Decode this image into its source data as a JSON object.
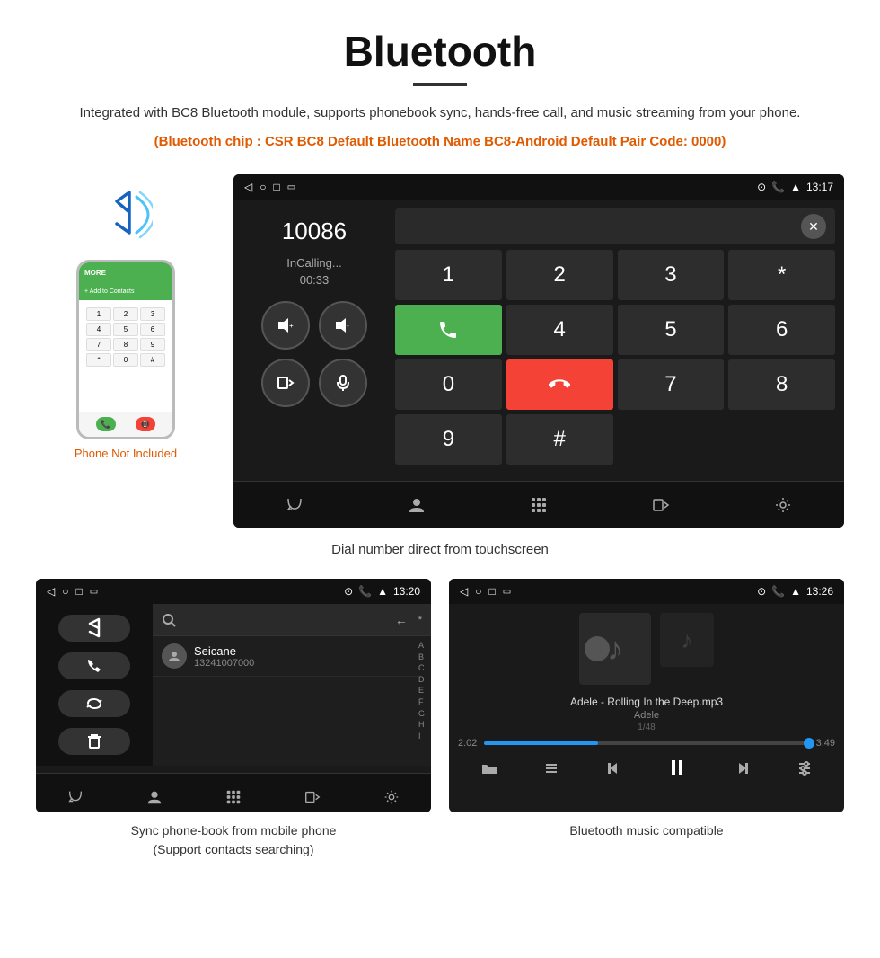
{
  "header": {
    "title": "Bluetooth",
    "description": "Integrated with BC8 Bluetooth module, supports phonebook sync, hands-free call, and music streaming from your phone.",
    "specs": "(Bluetooth chip : CSR BC8    Default Bluetooth Name BC8-Android    Default Pair Code: 0000)"
  },
  "dial_screen": {
    "status_time": "13:17",
    "phone_number": "10086",
    "call_status": "InCalling...",
    "timer": "00:33",
    "keypad": [
      "1",
      "2",
      "3",
      "*",
      "4",
      "5",
      "6",
      "0",
      "7",
      "8",
      "9",
      "#"
    ],
    "caption": "Dial number direct from touchscreen"
  },
  "phonebook_screen": {
    "status_time": "13:20",
    "contact_name": "Seicane",
    "contact_number": "13241007000",
    "caption_line1": "Sync phone-book from mobile phone",
    "caption_line2": "(Support contacts searching)"
  },
  "music_screen": {
    "status_time": "13:26",
    "track_name": "Adele - Rolling In the Deep.mp3",
    "artist": "Adele",
    "track_count": "1/48",
    "time_current": "2:02",
    "time_total": "3:49",
    "caption": "Bluetooth music compatible"
  },
  "phone_illustration": {
    "not_included_label": "Phone Not Included"
  }
}
